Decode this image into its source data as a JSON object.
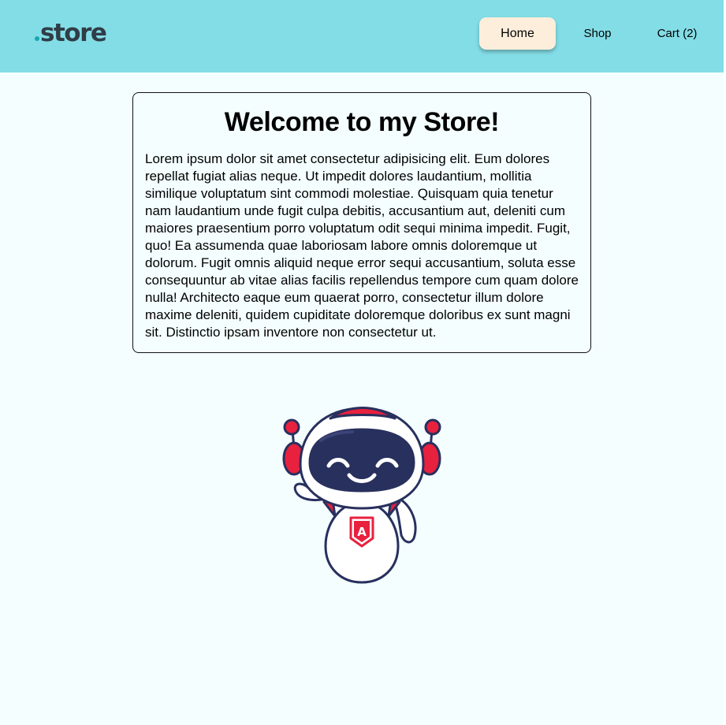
{
  "header": {
    "logo": "store",
    "logo_accent_color": "#18a6b2",
    "bg_color": "#83dde6"
  },
  "nav": {
    "home": "Home",
    "shop": "Shop",
    "cart": "Cart (2)",
    "active": "home"
  },
  "welcome": {
    "title": "Welcome to my Store!",
    "body": "Lorem ipsum dolor sit amet consectetur adipisicing elit. Eum dolores repellat fugiat alias neque. Ut impedit dolores laudantium, mollitia similique voluptatum sint commodi molestiae. Quisquam quia tenetur nam laudantium unde fugit culpa debitis, accusantium aut, deleniti cum maiores praesentium porro voluptatum odit sequi minima impedit. Fugit, quo! Ea assumenda quae laboriosam labore omnis doloremque ut dolorum. Fugit omnis aliquid neque error sequi accusantium, soluta esse consequuntur ab vitae alias facilis repellendus tempore cum quam dolore nulla! Architecto eaque eum quaerat porro, consectetur illum dolore maxime deleniti, quidem cupiditate doloremque doloribus ex sunt magni sit. Distinctio ipsam inventore non consectetur ut."
  },
  "mascot": {
    "icon": "robot-mascot-icon",
    "badge_letter": "A",
    "accent_color": "#e8213f",
    "visor_color": "#28305e"
  }
}
